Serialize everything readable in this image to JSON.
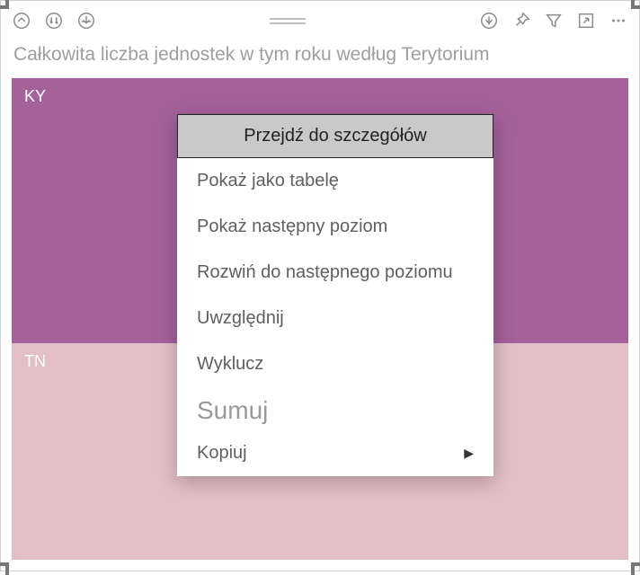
{
  "title": "Całkowita liczba jednostek w tym roku według Terytorium",
  "chart_data": {
    "type": "bar",
    "orientation": "treemap",
    "categories": [
      "KY",
      "TN"
    ],
    "values": [
      55,
      45
    ],
    "title": "Całkowita liczba jednostek w tym roku według Terytorium",
    "colors": [
      "#a4619a",
      "#e3bec7"
    ]
  },
  "segments": {
    "ky": {
      "label": "KY"
    },
    "tn": {
      "label": "TN"
    }
  },
  "toolbar": {
    "drill_up": "drill-up",
    "drill_down_all": "drill-down-all",
    "drill_expand": "drill-expand",
    "focus": "focus-mode",
    "pin": "pin",
    "filter": "filter",
    "popout": "popout",
    "more": "more"
  },
  "context_menu": {
    "header": "Przejdź do szczegółów",
    "items": [
      {
        "label": "Pokaż jako tabelę"
      },
      {
        "label": "Pokaż następny poziom"
      },
      {
        "label": "Rozwiń do następnego poziomu"
      },
      {
        "label": "Uwzględnij"
      },
      {
        "label": "Wyklucz"
      }
    ],
    "summarize": "Sumuj",
    "copy": "Kopiuj"
  }
}
